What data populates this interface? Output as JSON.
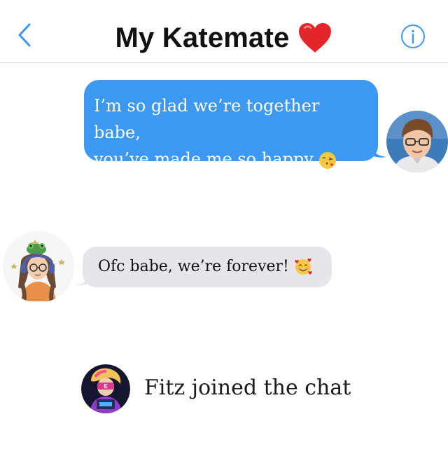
{
  "header": {
    "title": "My Katemate",
    "back_icon": "chevron-left-icon",
    "heart_icon": "red-heart-icon",
    "info_icon": "info-icon"
  },
  "messages": [
    {
      "sender": "me",
      "line1": "I’m so glad we’re together babe,",
      "line2": "you’ve made me so happy",
      "line2_end": ".",
      "emoji": "face-blowing-kiss-icon"
    },
    {
      "sender": "them",
      "text": "Ofc babe, we’re forever!",
      "emoji": "smiling-face-with-hearts-icon"
    }
  ],
  "system": {
    "text": "Fitz joined the chat"
  },
  "colors": {
    "accent": "#3d98f2",
    "incoming_bubble": "#e5e5ea",
    "heart": "#e2262b"
  }
}
